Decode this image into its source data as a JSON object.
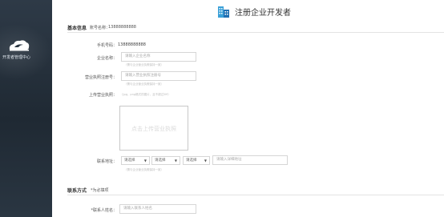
{
  "sidebar": {
    "label": "开发者管理中心",
    "logo_icon": "cloud-bird-icon"
  },
  "header": {
    "title": "注册企业开发者",
    "icon": "building-icon"
  },
  "basic_info": {
    "title": "基本信息",
    "account_label": "账号名称：",
    "account_value": "13888888888"
  },
  "form": {
    "phone_label": "手机号码：",
    "phone_value": "13888888888",
    "company_label": "企业名称：",
    "company_placeholder": "请输入企业名称",
    "company_hint": "（需与企业营业执照保持一致）",
    "license_label": "营业执照注册号：",
    "license_placeholder": "请输入营业执照注册号",
    "license_hint": "（需与企业营业执照保持一致）",
    "upload_label": "上传营业执照：",
    "upload_tip": "（jpg、png格式的图片，且不超过2M）",
    "upload_text": "点击上传营业执照",
    "address_label": "联系地址：",
    "select_province": "请选择",
    "select_city": "请选择",
    "select_district": "请选择",
    "address_placeholder": "请输入详细地址",
    "address_hint": "（需与企业营业执照保持一致）"
  },
  "contact": {
    "title": "联系方式",
    "required_note": "*为必填项",
    "name_label": "*联系人姓名：",
    "name_placeholder": "请输入联系人姓名"
  },
  "colors": {
    "sidebar": "#2a3642",
    "border": "#d6d6d6",
    "hint": "#bbbbbb"
  }
}
